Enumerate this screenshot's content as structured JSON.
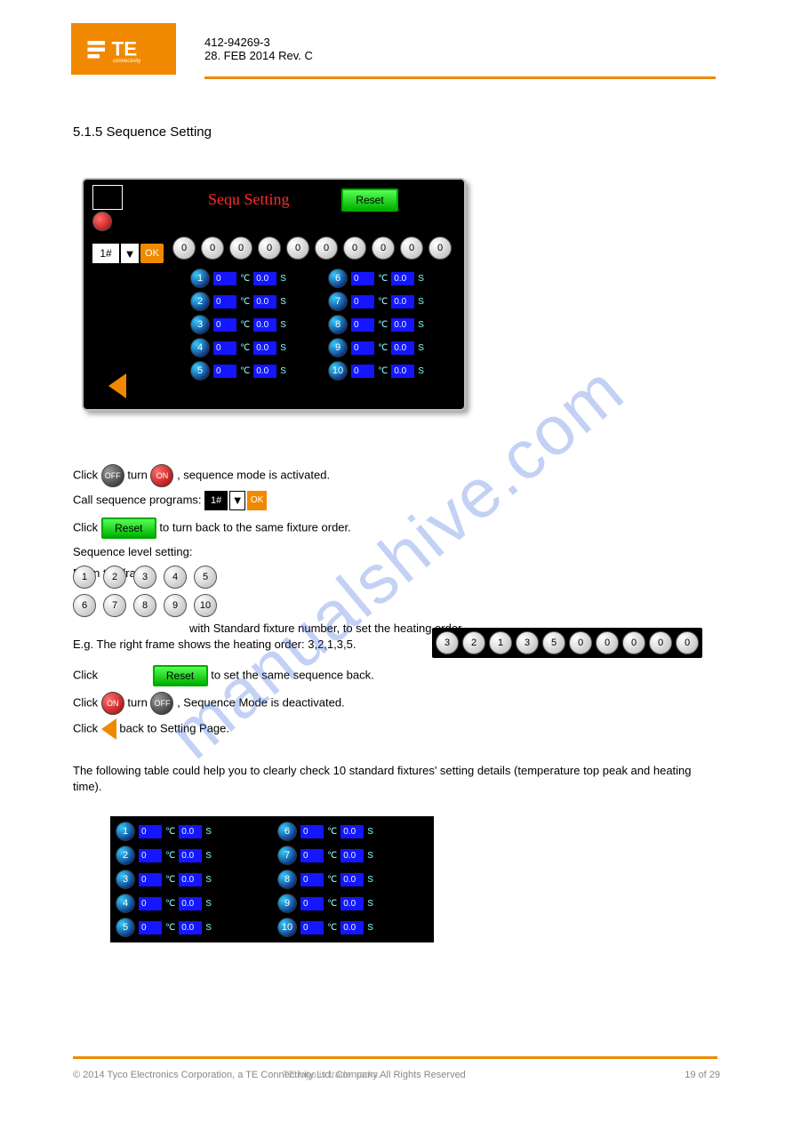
{
  "header": {
    "doc_ref": "412-94269-3",
    "doc_date": "28. FEB 2014 Rev. C",
    "section_title": "5.1.5 Sequence Setting"
  },
  "hmi": {
    "title": "Sequ Setting",
    "reset": "Reset",
    "select_value": "1#",
    "ok": "OK",
    "top_dials": [
      "0",
      "0",
      "0",
      "0",
      "0",
      "0",
      "0",
      "0",
      "0",
      "0"
    ],
    "rows": [
      {
        "idx": "1",
        "t": "0",
        "s": "0.0"
      },
      {
        "idx": "2",
        "t": "0",
        "s": "0.0"
      },
      {
        "idx": "3",
        "t": "0",
        "s": "0.0"
      },
      {
        "idx": "4",
        "t": "0",
        "s": "0.0"
      },
      {
        "idx": "5",
        "t": "0",
        "s": "0.0"
      },
      {
        "idx": "6",
        "t": "0",
        "s": "0.0"
      },
      {
        "idx": "7",
        "t": "0",
        "s": "0.0"
      },
      {
        "idx": "8",
        "t": "0",
        "s": "0.0"
      },
      {
        "idx": "9",
        "t": "0",
        "s": "0.0"
      },
      {
        "idx": "10",
        "t": "0",
        "s": "0.0"
      }
    ]
  },
  "text": {
    "line_a": "Click",
    "line_a2": "turn",
    "line_a3": ", sequence mode is activated.",
    "line_b": "Call sequence programs: ",
    "line_c": "Click",
    "line_c2": "to turn back to the same fixture order.",
    "line_d": "Sequence level setting:",
    "line_e": "Fill in the frame",
    "line_e2": " with Standard fixture number, to set the heating order.",
    "line_f": "E.g. The right frame shows the heating order: 3,2,1,3,5.",
    "line_g": "Click",
    "line_g2": " to set the same sequence back.",
    "line_h": "Click",
    "line_h2": "turn",
    "line_h3": ", Sequence Mode is deactivated.",
    "line_i": "Click",
    "line_i2": " back to Setting Page.",
    "line_j": "The following table could help you to clearly check 10 standard fixtures' setting details (temperature top peak and heating time)."
  },
  "widgets": {
    "off": "OFF",
    "on": "ON",
    "reset": "Reset",
    "ok": "OK",
    "select": "1#"
  },
  "dials_block": [
    "1",
    "2",
    "3",
    "4",
    "5",
    "6",
    "7",
    "8",
    "9",
    "10"
  ],
  "dials_example": [
    "3",
    "2",
    "1",
    "3",
    "5",
    "0",
    "0",
    "0",
    "0",
    "0"
  ],
  "detail_rows": [
    {
      "idx": "1",
      "t": "0",
      "s": "0.0"
    },
    {
      "idx": "2",
      "t": "0",
      "s": "0.0"
    },
    {
      "idx": "3",
      "t": "0",
      "s": "0.0"
    },
    {
      "idx": "4",
      "t": "0",
      "s": "0.0"
    },
    {
      "idx": "5",
      "t": "0",
      "s": "0.0"
    },
    {
      "idx": "6",
      "t": "0",
      "s": "0.0"
    },
    {
      "idx": "7",
      "t": "0",
      "s": "0.0"
    },
    {
      "idx": "8",
      "t": "0",
      "s": "0.0"
    },
    {
      "idx": "9",
      "t": "0",
      "s": "0.0"
    },
    {
      "idx": "10",
      "t": "0",
      "s": "0.0"
    }
  ],
  "footer": {
    "left": "© 2014 Tyco Electronics Corporation, a TE Connectivity Ltd. Company All Rights Reserved",
    "mid": "TE logo is trademarks.",
    "right_top": "",
    "right_mid": "19 of 29",
    "right_bot": ""
  },
  "watermark": "manualshive.com"
}
